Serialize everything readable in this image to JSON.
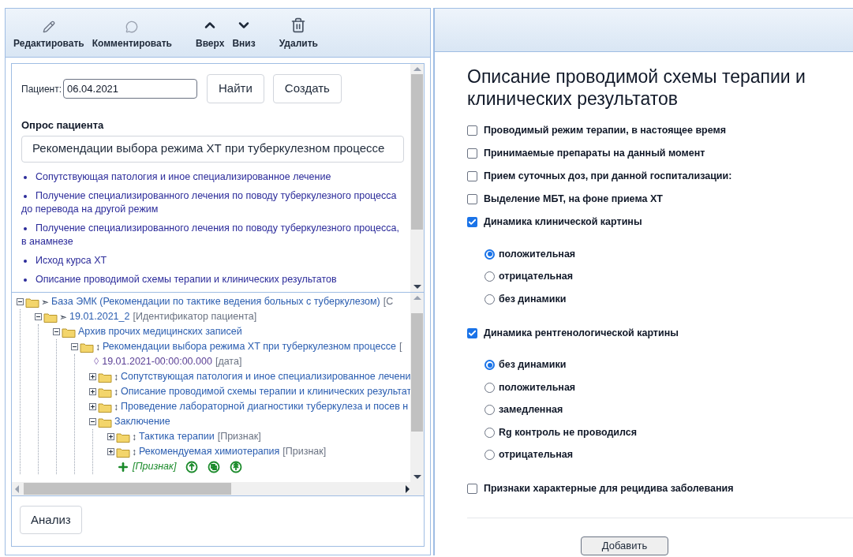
{
  "toolbar": [
    {
      "label": "Редактировать",
      "kind": "edit"
    },
    {
      "label": "Комментировать",
      "kind": "comment"
    },
    {
      "label": "Вверх",
      "kind": "up"
    },
    {
      "label": "Вниз",
      "kind": "down"
    },
    {
      "label": "Удалить",
      "kind": "delete"
    }
  ],
  "patient": {
    "label": "Пациент:",
    "value": "06.04.2021"
  },
  "buttons": [
    "Найти",
    "Создать"
  ],
  "survey": {
    "title": "Опрос пациента",
    "value": "Рекомендации выбора режима ХТ при туберкулезном процессе"
  },
  "links": [
    "Сопутствующая патология и иное специализированное лечение",
    "Получение специализированного лечения по поводу туберкулезного процесса до перевода на другой режим",
    "Получение специализированного лечения по поводу туберкулезного процесса, в анамнезе",
    "Исход курса ХТ",
    "Описание проводимой схемы терапии и клинических результатов"
  ],
  "tree": [
    {
      "kind": "node",
      "marker": "➣",
      "label": "База ЭМК (Рекомендации по тактике ведения больных с туберкулезом)",
      "tag": "[С",
      "expanded": true,
      "children": [
        {
          "kind": "node",
          "marker": "➣",
          "label": "19.01.2021_2",
          "tag": "[Идентификатор пациента]",
          "expanded": true,
          "children": [
            {
              "kind": "node",
              "label": "Архив прочих медицинских записей",
              "expanded": true,
              "children": [
                {
                  "kind": "node",
                  "marker": "↕",
                  "label": "Рекомендации выбора режима ХТ при туберкулезном процессе",
                  "tag": "[",
                  "expanded": true,
                  "children": [
                    {
                      "kind": "value",
                      "marker": "◊",
                      "label": "19.01.2021-00:00:00.000",
                      "tag": "[дата]"
                    },
                    {
                      "kind": "node",
                      "marker": "↕",
                      "label": "Сопутствующая патология и иное специализированное лечени",
                      "expanded": false
                    },
                    {
                      "kind": "node",
                      "marker": "↕",
                      "label": "Описание проводимой схемы терапии и клинических результат",
                      "expanded": false
                    },
                    {
                      "kind": "node",
                      "marker": "↕",
                      "label": "Проведение лабораторной диагностики туберкулеза и посев н",
                      "expanded": false
                    },
                    {
                      "kind": "node",
                      "label": "Заключение",
                      "expanded": true,
                      "children": [
                        {
                          "kind": "node",
                          "marker": "↕",
                          "label": "Тактика терапии",
                          "tag": "[Признак]",
                          "expanded": false
                        },
                        {
                          "kind": "node",
                          "marker": "↕",
                          "label": "Рекомендуемая химиотерапия",
                          "tag": "[Признак]",
                          "expanded": false
                        },
                        {
                          "kind": "add",
                          "label": "[Признак]"
                        }
                      ]
                    }
                  ]
                }
              ]
            }
          ]
        }
      ]
    }
  ],
  "analyze_button": "Анализ",
  "form": {
    "title": "Описание проводимой схемы терапии и клинических результатов",
    "items": [
      {
        "label": "Проводимый режим терапии, в настоящее время",
        "checked": false
      },
      {
        "label": "Принимаемые препараты на данный момент",
        "checked": false
      },
      {
        "label": "Прием суточных доз, при данной госпитализации:",
        "checked": false
      },
      {
        "label": "Выделение МБТ, на фоне приема ХТ",
        "checked": false
      },
      {
        "label": "Динамика клинической картины",
        "checked": true,
        "options": [
          {
            "label": "положительная",
            "selected": true
          },
          {
            "label": "отрицательная",
            "selected": false
          },
          {
            "label": "без динамики",
            "selected": false
          }
        ]
      },
      {
        "label": "Динамика рентгенологической картины",
        "checked": true,
        "options": [
          {
            "label": "без динамики",
            "selected": true
          },
          {
            "label": "положительная",
            "selected": false
          },
          {
            "label": "замедленная",
            "selected": false
          },
          {
            "label": "Rg контроль не проводился",
            "selected": false
          },
          {
            "label": "отрицательная",
            "selected": false
          }
        ]
      },
      {
        "label": "Признаки характерные для рецидива заболевания",
        "checked": false
      }
    ],
    "submit": "Добавить"
  }
}
